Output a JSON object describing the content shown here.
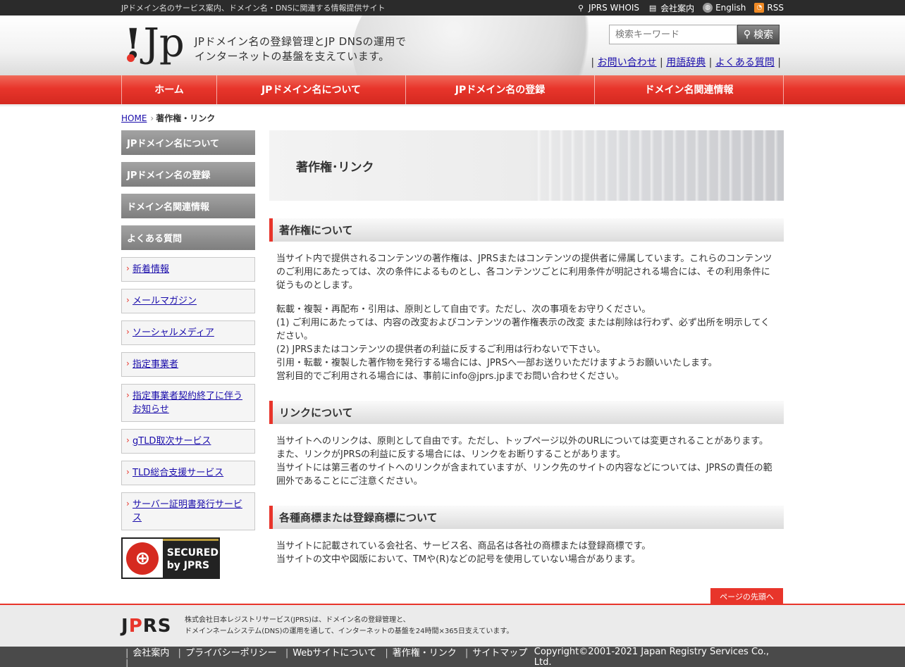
{
  "topbar": {
    "description": "JPドメイン名のサービス案内、ドメイン名・DNSに関連する情報提供サイト",
    "links": [
      {
        "label": "JPRS WHOIS",
        "icon": "search-icon"
      },
      {
        "label": "会社案内",
        "icon": "document-icon"
      },
      {
        "label": "English",
        "icon": "globe-icon"
      },
      {
        "label": "RSS",
        "icon": "rss-icon"
      }
    ]
  },
  "header": {
    "tagline_line1": "JPドメイン名の登録管理とJP DNSの運用で",
    "tagline_line2": "インターネットの基盤を支えています。",
    "search_placeholder": "検索キーワード",
    "search_button": "検索",
    "links": [
      "お問い合わせ",
      "用語辞典",
      "よくある質問"
    ]
  },
  "gnav": [
    "ホーム",
    "JPドメイン名について",
    "JPドメイン名の登録",
    "ドメイン名関連情報"
  ],
  "breadcrumb": {
    "home": "HOME",
    "current": "著作権・リンク"
  },
  "sidebar": {
    "categories": [
      "JPドメイン名について",
      "JPドメイン名の登録",
      "ドメイン名関連情報",
      "よくある質問"
    ],
    "links": [
      "新着情報",
      "メールマガジン",
      "ソーシャルメディア",
      "指定事業者",
      "指定事業者契約終了に伴うお知らせ",
      "gTLD取次サービス",
      "TLD総合支援サービス",
      "サーバー証明書発行サービス"
    ],
    "seal_line1": "SECURED",
    "seal_line2": "by JPRS"
  },
  "main": {
    "title": "著作権･リンク",
    "sections": [
      {
        "heading": "著作権について",
        "p1": "当サイト内で提供されるコンテンツの著作権は、JPRSまたはコンテンツの提供者に帰属しています。これらのコンテンツのご利用にあたっては、次の条件によるものとし、各コンテンツごとに利用条件が明記される場合には、その利用条件に従うものとします。",
        "p2_lines": [
          "転載・複製・再配布・引用は、原則として自由です。ただし、次の事項をお守りください。",
          "(1) ご利用にあたっては、内容の改変およびコンテンツの著作権表示の改変 または削除は行わず、必ず出所を明示してください。",
          "(2) JPRSまたはコンテンツの提供者の利益に反するご利用は行わないで下さい。",
          "引用・転載・複製した著作物を発行する場合には、JPRSへ一部お送りいただけますようお願いいたします。",
          "営利目的でご利用される場合には、事前にinfo@jprs.jpまでお問い合わせください。"
        ]
      },
      {
        "heading": "リンクについて",
        "lines": [
          "当サイトへのリンクは、原則として自由です。ただし、トップページ以外のURLについては変更されることがあります。",
          "また、リンクがJPRSの利益に反する場合には、リンクをお断りすることがあります。",
          "当サイトには第三者のサイトへのリンクが含まれていますが、リンク先のサイトの内容などについては、JPRSの責任の範囲外であることにご注意ください。"
        ]
      },
      {
        "heading": "各種商標または登録商標について",
        "lines": [
          "当サイトに記載されている会社名、サービス名、商品名は各社の商標または登録商標です。",
          "当サイトの文中や図版において、TMや(R)などの記号を使用していない場合があります。"
        ]
      }
    ]
  },
  "to_top": "ページの先頭へ",
  "footer": {
    "desc_line1": "株式会社日本レジストリサービス(JPRS)は、ドメイン名の登録管理と、",
    "desc_line2": "ドメインネームシステム(DNS)の運用を通して、インターネットの基盤を24時間×365日支えています。",
    "links": [
      "会社案内",
      "プライバシーポリシー",
      "Webサイトについて",
      "著作権・リンク",
      "サイトマップ"
    ],
    "copyright": "Copyright©2001-2021 Japan Registry Services Co., Ltd."
  },
  "colors": {
    "accent": "#e8352b",
    "sidebar_category": "#8e8e8e",
    "bottom_bar": "#4a4a4a"
  }
}
